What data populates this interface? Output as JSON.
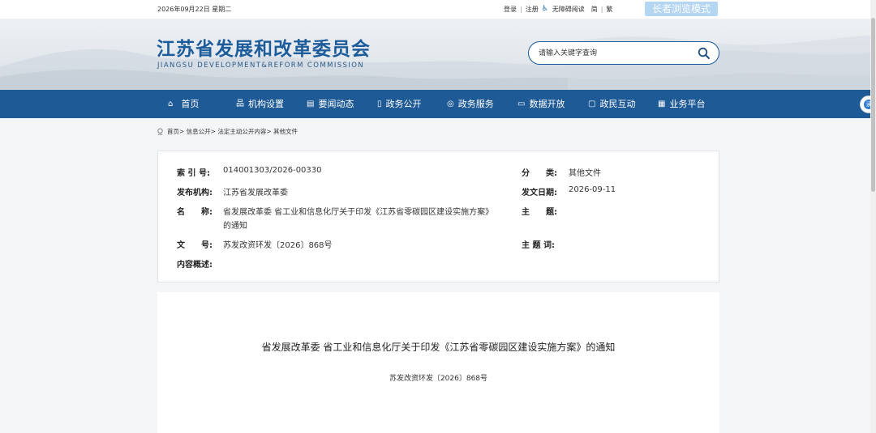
{
  "topbar": {
    "date": "2026年09月22日 星期二",
    "login": "登录",
    "separator": "|",
    "register": "注册",
    "accessible": "无障碍阅读",
    "simplified": "简",
    "traditional": "繁",
    "elder_mode": "长者浏览模式"
  },
  "header": {
    "title": "江苏省发展和改革委员会",
    "subtitle": "JIANGSU DEVELOPMENT&REFORM COMMISSION",
    "search_placeholder": "请输入关键字查询"
  },
  "nav": {
    "items": [
      {
        "label": "首页",
        "icon": "home-icon"
      },
      {
        "label": "机构设置",
        "icon": "org-icon"
      },
      {
        "label": "要闻动态",
        "icon": "news-icon"
      },
      {
        "label": "政务公开",
        "icon": "doc-icon"
      },
      {
        "label": "政务服务",
        "icon": "service-icon"
      },
      {
        "label": "数据开放",
        "icon": "data-icon"
      },
      {
        "label": "政民互动",
        "icon": "chat-icon"
      },
      {
        "label": "业务平台",
        "icon": "grid-icon"
      }
    ],
    "float_label": "读"
  },
  "breadcrumb": "首页> 信息公开> 法定主动公开内容> 其他文件",
  "meta": {
    "index_label": "索 引 号:",
    "index_value": "014001303/2026-00330",
    "category_label": "分　　类:",
    "category_value": "其他文件",
    "issuer_label": "发布机构:",
    "issuer_value": "江苏省发展改革委",
    "date_label": "发文日期:",
    "date_value": "2026-09-11",
    "name_label": "名　　称:",
    "name_value_line1": "省发展改革委 省工业和信息化厅关于印发《江苏省零碳园区建设实施方案》",
    "name_value_line2": "的通知",
    "topic_label": "主　　题:",
    "topic_value": "",
    "docno_label": "文　　号:",
    "docno_value": "苏发改资环发〔2026〕868号",
    "keywords_label": "主 题 词:",
    "keywords_value": "",
    "summary_label": "内容概述:",
    "summary_value": ""
  },
  "article": {
    "title": "省发展改革委 省工业和信息化厅关于印发《江苏省零碳园区建设实施方案》的通知",
    "doc_no": "苏发改资环发〔2026〕868号"
  },
  "colors": {
    "brand": "#1d5c9b",
    "nav_bg": "#1e5a96",
    "elder_btn": "#b4d6f2"
  }
}
